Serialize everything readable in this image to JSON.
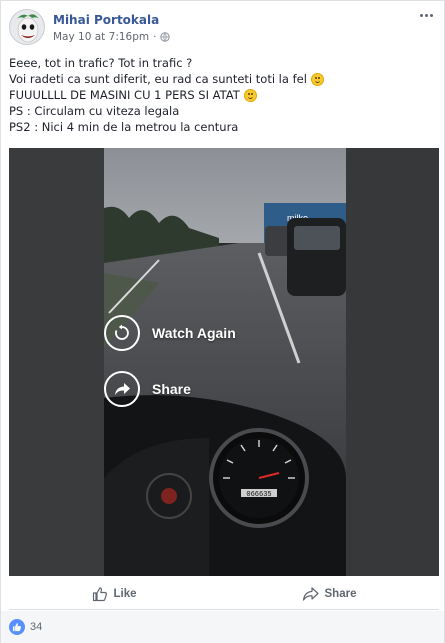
{
  "post": {
    "author": "Mihai Portokala",
    "timestamp": "May 10 at 7:16pm",
    "privacy_icon": "globe-icon",
    "lines": [
      "Eeee, tot in trafic? Tot in trafic ?",
      "Voi radeti ca sunt diferit, eu rad ca sunteti toti la fel",
      "FUUULLLL DE MASINI CU 1 PERS SI ATAT",
      "PS : Circulam cu viteza legala",
      "PS2 : Nici 4 min de la metrou la centura"
    ]
  },
  "video": {
    "watch_again_label": "Watch Again",
    "share_label": "Share",
    "truck_sign": "milko",
    "odometer": "066635"
  },
  "actions": {
    "like_label": "Like",
    "share_label": "Share"
  },
  "reactions": {
    "count": "34"
  },
  "colors": {
    "author_link": "#385898",
    "like_bubble": "#5890ff",
    "meta_text": "#616770"
  }
}
